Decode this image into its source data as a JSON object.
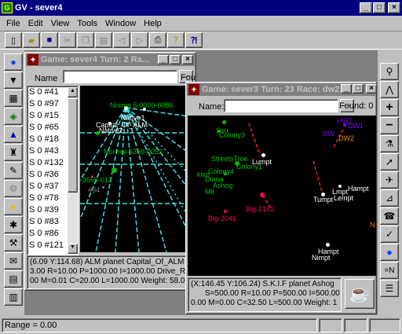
{
  "app": {
    "title": "GV - sever4"
  },
  "menu": [
    "File",
    "Edit",
    "View",
    "Tools",
    "Window",
    "Help"
  ],
  "toolbar": [
    "new",
    "open",
    "save",
    "cut",
    "copy",
    "paste",
    "back",
    "forward",
    "print",
    "help",
    "context-help"
  ],
  "right_tools": [
    "zoom-icon",
    "compass-icon",
    "plus-icon",
    "minus-icon",
    "tool-icon",
    "tool-icon",
    "tool-icon",
    "tool-icon",
    "tool-icon",
    "tool-icon",
    "tool-icon",
    "tool-icon",
    "tool-icon",
    "tool-icon"
  ],
  "left_tools": [
    "globe-icon",
    "filter-icon",
    "grid-icon",
    "ships-icon",
    "chart-icon",
    "robot-icon",
    "pen-icon",
    "tool-icon",
    "bulb-icon",
    "gear-icon",
    "tool-icon",
    "mail-icon",
    "doc-icon",
    "table-icon"
  ],
  "status": {
    "range": "Range = 0.00"
  },
  "win1": {
    "title": "Game: sever4   Turn: 2   Ra...",
    "name_label": "Name",
    "found_label": "Fou",
    "list": [
      "S 0 #41",
      "S 0 #97",
      "S 0 #15",
      "S 0 #65",
      "S 0 #18",
      "S 0 #43",
      "S 0 #132",
      "S 0 #36",
      "S 0 #37",
      "S 0 #78",
      "S 0 #39",
      "S 0 #83",
      "S 0 #86",
      "S 0 #121"
    ],
    "map_labels": {
      "normal1": "Norma 5-0000-0086",
      "capital": "Capital_Of_ALM",
      "native2": "Native2",
      "native1": "Native1",
      "normal2": "Normal-5369-0052",
      "n3": "-9565-012",
      "n94": "#94"
    },
    "info": [
      "(6.09 Y:114.68) ALM planet Capital_Of_ALM (",
      "3.00 R=10.00 P=1000.00 I=1000.00   Drive_Re:",
      "00 M=0.01 C=20.00 L=1000.00    Weight: 58.00"
    ]
  },
  "win2": {
    "title": "Game: sever3   Turn: 23   Race: dw2",
    "name_label": "Name:",
    "found_label": "Found: 0",
    "map_labels": {
      "ssu": "Ssu",
      "colony3": "Colony3",
      "lumpt": "Lumpt",
      "streets": "StreetsTroe",
      "colony1": "Colony1",
      "colony4": "Colony4",
      "klim": "klim",
      "diana": "Diana",
      "ashog": "Ashog",
      "mit": "Mit",
      "big2161": "Big-2161",
      "big2041": "Big-2041",
      "hw2": "HW2",
      "dw1": "DW1",
      "dw2": "DW2",
      "dwx": "DW",
      "lmpt": "Lmpt",
      "hampt1": "Hampt",
      "tumpt": "Tumpt",
      "lempt": "Lempt",
      "hampt2": "Hampt",
      "nimpt": "Nimpt",
      "n": "N"
    },
    "info": [
      "(X:146.45 Y:106.24) S.K.I.F planet Ashog",
      "S=500.00 R=10.00 P=500.00 I=500.00",
      "0.00 M=0.00 C=32.50 L=500.00   Weight: 1"
    ]
  },
  "colors": {
    "title_active": "#000080",
    "title_inactive": "#808080",
    "planet_green": "#00c000",
    "planet_magenta": "#ff0060",
    "planet_white": "#ffffff",
    "planet_purple": "#8000ff",
    "grid_cyan": "#40e0e0"
  }
}
